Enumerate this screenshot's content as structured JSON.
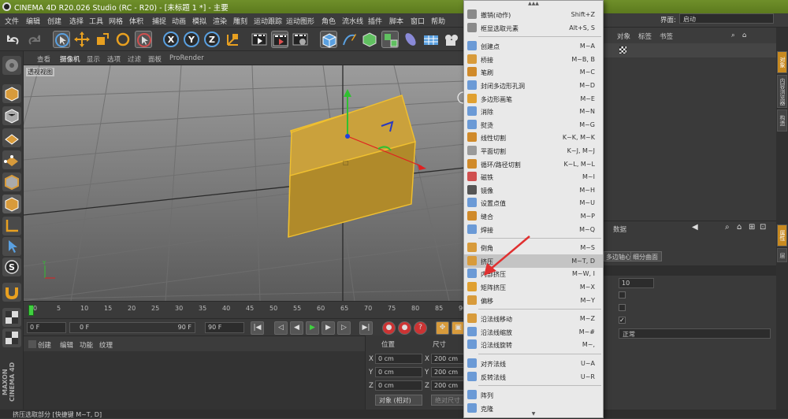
{
  "window": {
    "title": "CINEMA 4D R20.026 Studio (RC - R20) - [未标题 1 *] - 主要"
  },
  "menubar": {
    "items": [
      "文件",
      "编辑",
      "创建",
      "选择",
      "工具",
      "网格",
      "体积",
      "捕捉",
      "动画",
      "模拟",
      "渲染",
      "雕刻",
      "运动跟踪",
      "运动图形",
      "角色",
      "流水线",
      "插件",
      "脚本",
      "窗口",
      "帮助"
    ],
    "layout_label": "界面:",
    "layout_value": "启动"
  },
  "viewport_header": {
    "tabs": [
      "查看",
      "摄像机",
      "显示",
      "选项",
      "过滤",
      "面板",
      "ProRender"
    ],
    "view_name": "透视视图"
  },
  "timeline": {
    "ticks": [
      "0",
      "5",
      "10",
      "15",
      "20",
      "25",
      "30",
      "35",
      "40",
      "45",
      "50",
      "55",
      "60",
      "65",
      "70",
      "75",
      "80",
      "85",
      "90"
    ]
  },
  "transport": {
    "current_frame": "0 F",
    "range_start": "0 F",
    "range_end": "90 F",
    "max_frame": "90 F"
  },
  "material_panel": {
    "tabs": [
      "创建",
      "编辑",
      "功能",
      "纹理"
    ]
  },
  "coords": {
    "pos_label": "位置",
    "size_label": "尺寸",
    "axes": [
      "X",
      "Y",
      "Z"
    ],
    "pos_values": [
      "0 cm",
      "0 cm",
      "0 cm"
    ],
    "size_values": [
      "200 cm",
      "200 cm",
      "200 cm"
    ],
    "object_mode": "对象 (相对)",
    "apply_button": "绝对尺寸"
  },
  "right_panel": {
    "tabs": [
      "对象",
      "标签",
      "书签"
    ],
    "attr_header": "数据",
    "attr_tabs": [
      "多边轴心",
      "细分曲面"
    ],
    "field_value": "10",
    "dropdown_value": "正常"
  },
  "side_tabs": [
    "对象",
    "内容浏览器",
    "构造",
    "属性",
    "层"
  ],
  "status": {
    "text": "挤压选取部分 [快捷键 M~T, D]"
  },
  "menu": {
    "items": [
      {
        "label": "撤销(动作)",
        "shortcut": "Shift+Z",
        "icon_color": "#8a8a8a"
      },
      {
        "label": "框显选取元素",
        "shortcut": "Alt+S, S",
        "icon_color": "#8a8a8a"
      },
      {
        "sep": true
      },
      {
        "label": "创建点",
        "shortcut": "M~A",
        "icon_color": "#6b9ad6"
      },
      {
        "label": "桥接",
        "shortcut": "M~B, B",
        "icon_color": "#d89b3b"
      },
      {
        "label": "笔刷",
        "shortcut": "M~C",
        "icon_color": "#d08a2a"
      },
      {
        "label": "封闭多边形孔洞",
        "shortcut": "M~D",
        "icon_color": "#6b9ad6"
      },
      {
        "label": "多边形画笔",
        "shortcut": "M~E",
        "icon_color": "#e0a030"
      },
      {
        "label": "消除",
        "shortcut": "M~N",
        "icon_color": "#6b9ad6"
      },
      {
        "label": "熨烫",
        "shortcut": "M~G",
        "icon_color": "#6b9ad6"
      },
      {
        "label": "线性切割",
        "shortcut": "K~K, M~K",
        "icon_color": "#d08a2a"
      },
      {
        "label": "平面切割",
        "shortcut": "K~J, M~J",
        "icon_color": "#9a9a9a"
      },
      {
        "label": "循环/路径切割",
        "shortcut": "K~L, M~L",
        "icon_color": "#d08a2a"
      },
      {
        "label": "磁铁",
        "shortcut": "M~I",
        "icon_color": "#d05050"
      },
      {
        "label": "镜像",
        "shortcut": "M~H",
        "icon_color": "#555555"
      },
      {
        "label": "设置点值",
        "shortcut": "M~U",
        "icon_color": "#6b9ad6"
      },
      {
        "label": "缝合",
        "shortcut": "M~P",
        "icon_color": "#d08a2a"
      },
      {
        "label": "焊接",
        "shortcut": "M~Q",
        "icon_color": "#6b9ad6"
      },
      {
        "sep": true
      },
      {
        "label": "倒角",
        "shortcut": "M~S",
        "icon_color": "#d89b3b"
      },
      {
        "label": "挤压",
        "shortcut": "M~T, D",
        "icon_color": "#d89b3b",
        "highlight": true
      },
      {
        "label": "内部挤压",
        "shortcut": "M~W, I",
        "icon_color": "#6b9ad6"
      },
      {
        "label": "矩阵挤压",
        "shortcut": "M~X",
        "icon_color": "#e0a030"
      },
      {
        "label": "偏移",
        "shortcut": "M~Y",
        "icon_color": "#d89b3b"
      },
      {
        "sep": true
      },
      {
        "label": "沿法线移动",
        "shortcut": "M~Z",
        "icon_color": "#d89b3b"
      },
      {
        "label": "沿法线缩放",
        "shortcut": "M~#",
        "icon_color": "#6b9ad6"
      },
      {
        "label": "沿法线旋转",
        "shortcut": "M~,",
        "icon_color": "#6b9ad6"
      },
      {
        "sep": true
      },
      {
        "label": "对齐法线",
        "shortcut": "U~A",
        "icon_color": "#6b9ad6"
      },
      {
        "label": "反转法线",
        "shortcut": "U~R",
        "icon_color": "#6b9ad6"
      },
      {
        "sep": true
      },
      {
        "label": "阵列",
        "shortcut": "",
        "icon_color": "#6b9ad6"
      },
      {
        "label": "克隆",
        "shortcut": "",
        "icon_color": "#6b9ad6"
      }
    ]
  },
  "colors": {
    "accent": "#f0c030",
    "cube_fill": "#b8902a",
    "cube_edge": "#f0c030",
    "menu_bg": "#e9e9e9",
    "highlight": "#c4c4c4",
    "arrow": "#e03030"
  }
}
